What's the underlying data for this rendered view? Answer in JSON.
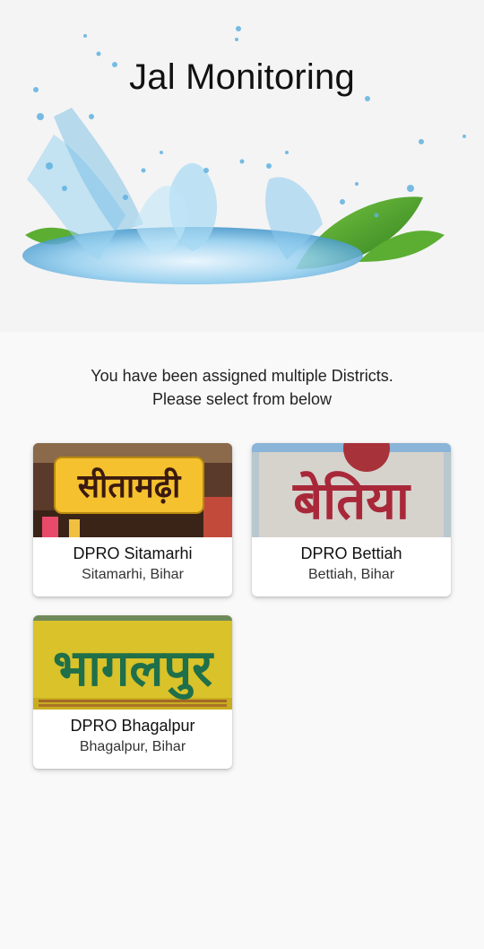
{
  "app": {
    "title": "Jal Monitoring"
  },
  "prompt": {
    "line1": "You have been assigned multiple Districts.",
    "line2": "Please select from below"
  },
  "districts": [
    {
      "title": "DPRO Sitamarhi",
      "subtitle": "Sitamarhi, Bihar",
      "sign_text": "सीतामढ़ी"
    },
    {
      "title": "DPRO Bettiah",
      "subtitle": "Bettiah, Bihar",
      "sign_text": "बेतिया"
    },
    {
      "title": "DPRO Bhagalpur",
      "subtitle": "Bhagalpur, Bihar",
      "sign_text": "भागलपुर"
    }
  ],
  "colors": {
    "background": "#f9f9f9",
    "water": "#7fc4e6",
    "leaf": "#4fa82f"
  }
}
